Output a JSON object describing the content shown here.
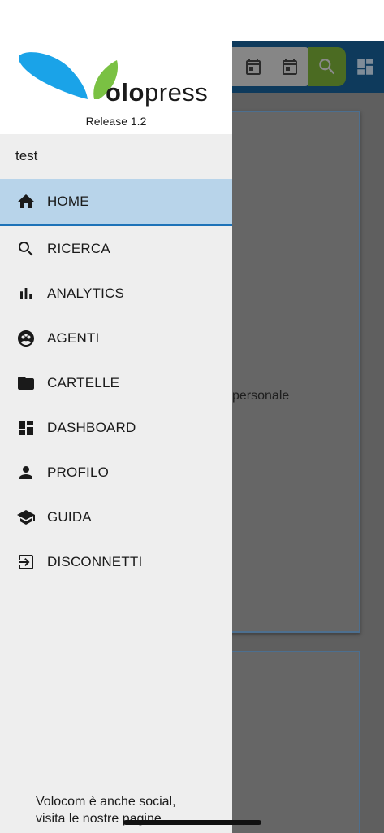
{
  "app": {
    "background_text": "personale",
    "colors": {
      "topbar": "#0e3a5c",
      "search_button": "#4b6b22",
      "overlay": "#5f5f5f"
    }
  },
  "drawer": {
    "brand": {
      "logo_text_bold": "olo",
      "logo_text_rest": "press",
      "release": "Release 1.2",
      "colors": {
        "blue": "#1aa3e8",
        "green": "#7ac143"
      }
    },
    "user": "test",
    "menu": [
      {
        "label": "HOME",
        "icon": "home-icon",
        "active": true
      },
      {
        "label": "RICERCA",
        "icon": "search-icon",
        "active": false
      },
      {
        "label": "ANALYTICS",
        "icon": "bar-chart-icon",
        "active": false
      },
      {
        "label": "AGENTI",
        "icon": "agents-icon",
        "active": false
      },
      {
        "label": "CARTELLE",
        "icon": "folder-icon",
        "active": false
      },
      {
        "label": "DASHBOARD",
        "icon": "dashboard-icon",
        "active": false
      },
      {
        "label": "PROFILO",
        "icon": "person-icon",
        "active": false
      },
      {
        "label": "GUIDA",
        "icon": "school-icon",
        "active": false
      },
      {
        "label": "DISCONNETTI",
        "icon": "logout-icon",
        "active": false
      }
    ],
    "active_color": "#b8d4ea",
    "social_line1": "Volocom è anche social,",
    "social_line2": "visita le nostre pagine"
  }
}
